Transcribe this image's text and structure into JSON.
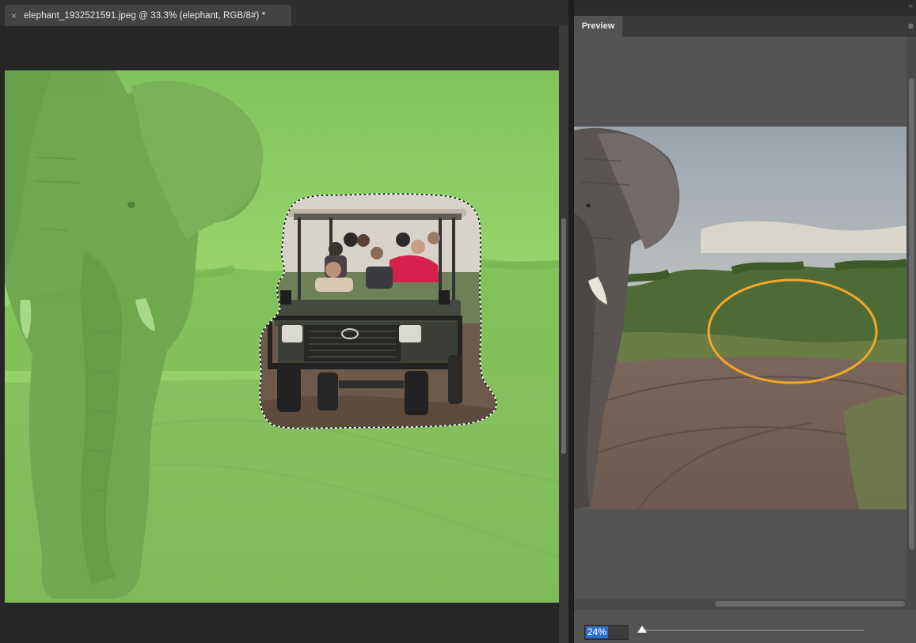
{
  "document": {
    "tab_title": "elephant_1932521591.jpeg @ 33.3% (elephant, RGB/8#) *",
    "close_glyph": "×"
  },
  "panel": {
    "collapse_glyph": "››",
    "tab_label": "Preview",
    "menu_glyph": "≡",
    "zoom_value": "24%",
    "zoom_fraction": 0.24
  },
  "colors": {
    "mask_green": "#8ac760",
    "annotation_ellipse": "#f2a72a",
    "zoom_highlight": "#2e6fd0"
  }
}
